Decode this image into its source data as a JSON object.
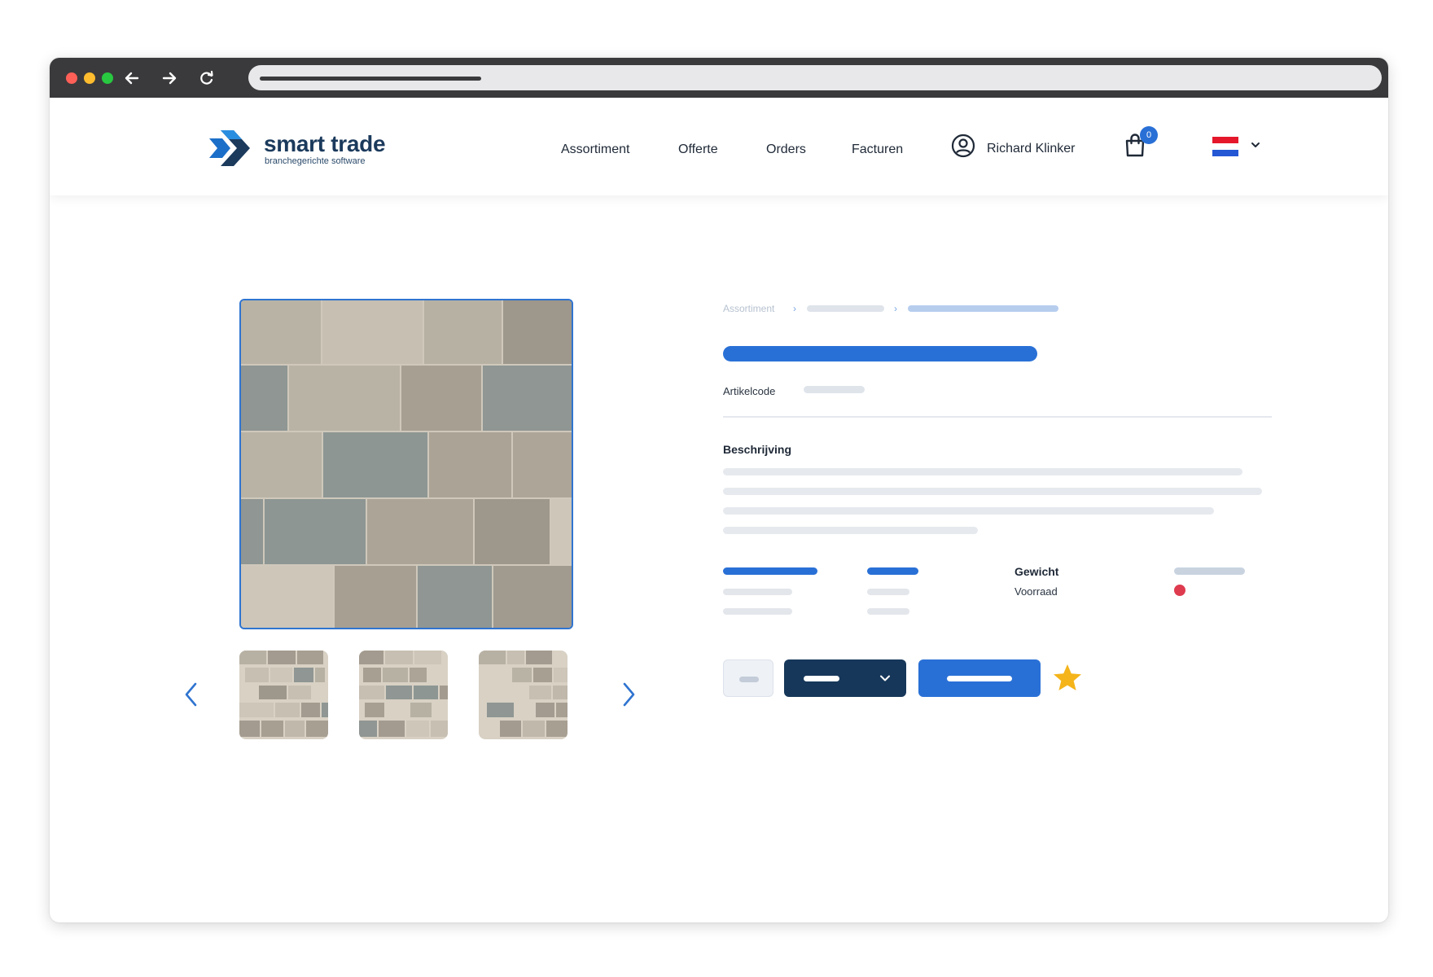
{
  "browser": {
    "icons": [
      "back-arrow-icon",
      "forward-arrow-icon",
      "reload-icon"
    ]
  },
  "header": {
    "logo": {
      "name": "smart trade",
      "tagline": "branchegerichte software"
    },
    "nav": [
      "Assortiment",
      "Offerte",
      "Orders",
      "Facturen"
    ],
    "user": {
      "name": "Richard Klinker"
    },
    "cart": {
      "count": "0"
    },
    "language": {
      "flag": "netherlands-flag",
      "colors": [
        "#e5172b",
        "#ffffff",
        "#2457d4"
      ]
    }
  },
  "product": {
    "breadcrumb": {
      "root": "Assortiment",
      "separator": "›"
    },
    "code_label": "Artikelcode",
    "description_label": "Beschrijving",
    "specs": {
      "weight_label": "Gewicht",
      "stock_label": "Voorraad",
      "stock_status_color": "#de3b4f"
    },
    "thumbnails": 3,
    "favorite_icon": "star-icon"
  },
  "colors": {
    "accent": "#2970d6",
    "navy": "#16375a",
    "star": "#f4b41a"
  }
}
